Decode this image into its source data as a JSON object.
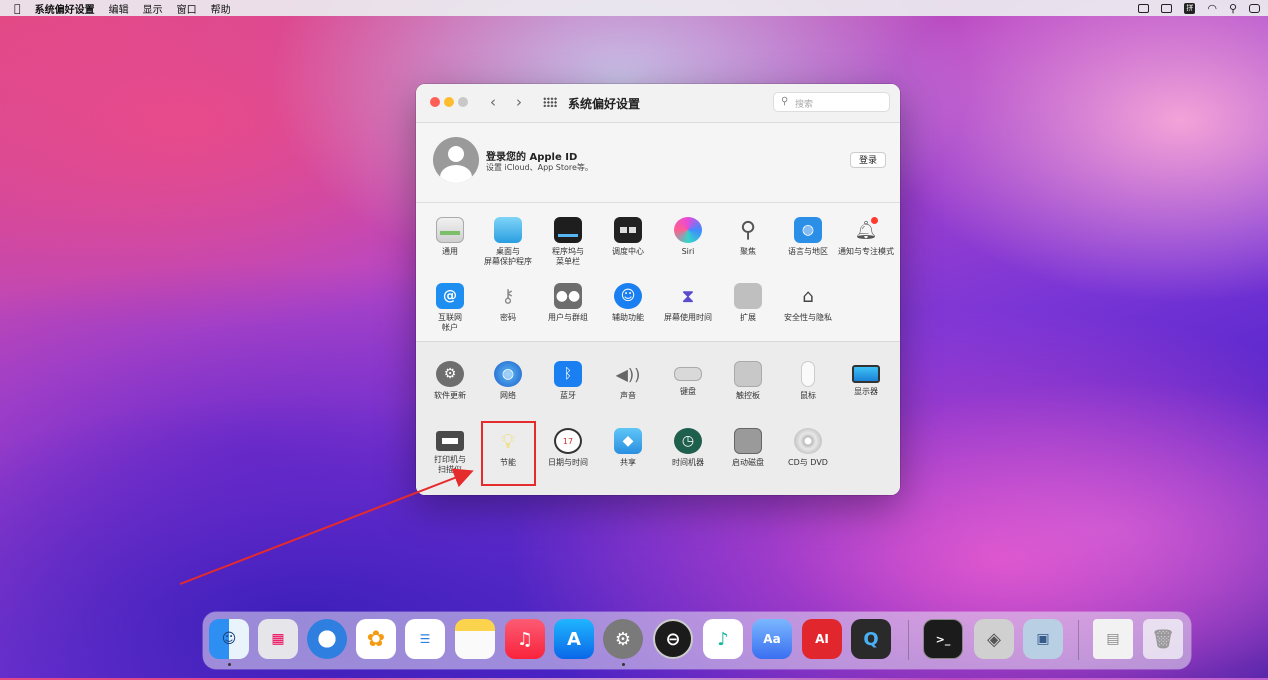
{
  "menubar": {
    "apple": "",
    "items": [
      "系统偏好设置",
      "编辑",
      "显示",
      "窗口",
      "帮助"
    ],
    "status_icons": [
      "drive-icon",
      "window-icon",
      "input-method-icon",
      "wifi-icon",
      "search-icon",
      "control-center-icon"
    ],
    "input_method": "拼"
  },
  "window": {
    "title": "系统偏好设置",
    "search_placeholder": "搜索",
    "back": "‹",
    "forward": "›",
    "account": {
      "name": "登录您的 Apple ID",
      "subtitle": "设置 iCloud、App Store等。",
      "login_button": "登录"
    },
    "row1": [
      {
        "label": "通用",
        "icon": "general-icon"
      },
      {
        "label": "桌面与\n屏幕保护程序",
        "icon": "desktop-icon"
      },
      {
        "label": "程序坞与\n菜单栏",
        "icon": "dock-icon"
      },
      {
        "label": "调度中心",
        "icon": "mission-control-icon"
      },
      {
        "label": "Siri",
        "icon": "siri-icon"
      },
      {
        "label": "聚焦",
        "icon": "spotlight-icon"
      },
      {
        "label": "语言与地区",
        "icon": "language-icon"
      },
      {
        "label": "通知与专注模式",
        "icon": "notifications-icon"
      }
    ],
    "row2": [
      {
        "label": "互联网\n帐户",
        "icon": "internet-accounts-icon",
        "glyph": "@"
      },
      {
        "label": "密码",
        "icon": "key-icon"
      },
      {
        "label": "用户与群组",
        "icon": "users-icon"
      },
      {
        "label": "辅助功能",
        "icon": "accessibility-icon"
      },
      {
        "label": "屏幕使用时间",
        "icon": "screen-time-icon"
      },
      {
        "label": "扩展",
        "icon": "extensions-icon"
      },
      {
        "label": "安全性与隐私",
        "icon": "security-icon"
      }
    ],
    "row3": [
      {
        "label": "软件更新",
        "icon": "software-update-icon"
      },
      {
        "label": "网络",
        "icon": "network-icon"
      },
      {
        "label": "蓝牙",
        "icon": "bluetooth-icon"
      },
      {
        "label": "声音",
        "icon": "sound-icon"
      },
      {
        "label": "键盘",
        "icon": "keyboard-icon"
      },
      {
        "label": "触控板",
        "icon": "trackpad-icon"
      },
      {
        "label": "鼠标",
        "icon": "mouse-icon"
      },
      {
        "label": "显示器",
        "icon": "displays-icon"
      }
    ],
    "row4": [
      {
        "label": "打印机与\n扫描仪",
        "icon": "printer-icon"
      },
      {
        "label": "节能",
        "icon": "energy-saver-icon"
      },
      {
        "label": "日期与时间",
        "icon": "date-time-icon",
        "glyph": "17"
      },
      {
        "label": "共享",
        "icon": "sharing-icon"
      },
      {
        "label": "时间机器",
        "icon": "time-machine-icon"
      },
      {
        "label": "启动磁盘",
        "icon": "startup-disk-icon"
      },
      {
        "label": "CD与 DVD",
        "icon": "cd-dvd-icon"
      }
    ]
  },
  "dock": {
    "apps": [
      "finder-icon",
      "launchpad-icon",
      "safari-icon",
      "photos-icon",
      "reminders-icon",
      "notes-icon",
      "music-icon",
      "app-store-icon",
      "system-preferences-icon",
      "disk-utility-icon",
      "music-ai-icon",
      "translate-icon",
      "ai-music-icon",
      "quicktime-icon",
      "terminal-icon",
      "boot-camp-icon",
      "preview-icon",
      "document-icon",
      "trash-icon"
    ]
  },
  "colors": {
    "accent": "#0a84ff",
    "highlight": "#e52b2b"
  }
}
